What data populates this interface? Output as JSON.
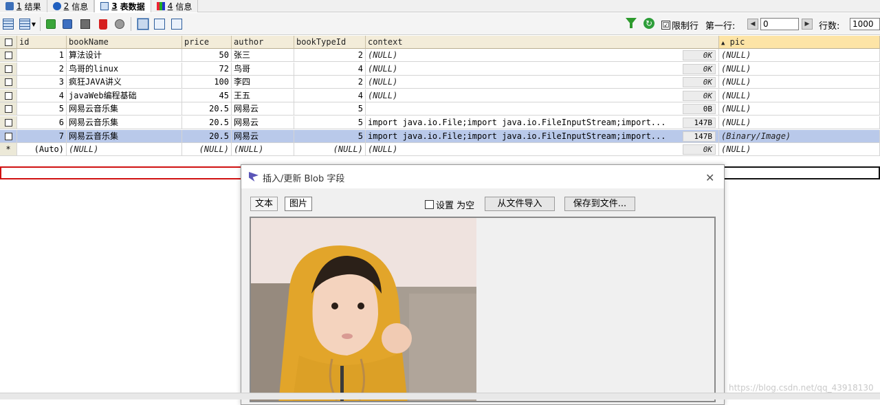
{
  "tabs": [
    {
      "num": "1",
      "label": "结果",
      "icon": "results-icon"
    },
    {
      "num": "2",
      "label": "信息",
      "icon": "info-icon"
    },
    {
      "num": "3",
      "label": "表数据",
      "icon": "table-data-icon"
    },
    {
      "num": "4",
      "label": "信息",
      "icon": "info-chart-icon"
    }
  ],
  "toolbar": {
    "limit_rows_label": "限制行",
    "limit_rows_checked": "☑",
    "first_row_label": "第一行:",
    "first_row_value": "0",
    "rows_label": "行数:",
    "rows_value": "1000"
  },
  "grid": {
    "columns": [
      "id",
      "bookName",
      "price",
      "author",
      "bookTypeId",
      "context",
      "pic"
    ],
    "sorted_marker": "▲",
    "rows": [
      {
        "id": "1",
        "bookName": "算法设计",
        "price": "50",
        "author": "张三",
        "bookTypeId": "2",
        "context": "(NULL)",
        "size": "0K",
        "pic": "(NULL)"
      },
      {
        "id": "2",
        "bookName": "鸟哥的linux",
        "price": "72",
        "author": "鸟哥",
        "bookTypeId": "4",
        "context": "(NULL)",
        "size": "0K",
        "pic": "(NULL)"
      },
      {
        "id": "3",
        "bookName": "疯狂JAVA讲义",
        "price": "100",
        "author": "李四",
        "bookTypeId": "2",
        "context": "(NULL)",
        "size": "0K",
        "pic": "(NULL)"
      },
      {
        "id": "4",
        "bookName": "javaWeb编程基础",
        "price": "45",
        "author": "王五",
        "bookTypeId": "4",
        "context": "(NULL)",
        "size": "0K",
        "pic": "(NULL)"
      },
      {
        "id": "5",
        "bookName": "网易云音乐集",
        "price": "20.5",
        "author": "网易云",
        "bookTypeId": "5",
        "context": "",
        "size": "0B",
        "pic": "(NULL)"
      },
      {
        "id": "6",
        "bookName": "网易云音乐集",
        "price": "20.5",
        "author": "网易云",
        "bookTypeId": "5",
        "context": "import java.io.File;import java.io.FileInputStream;import...",
        "size": "147B",
        "pic": "(NULL)"
      },
      {
        "id": "7",
        "bookName": "网易云音乐集",
        "price": "20.5",
        "author": "网易云",
        "bookTypeId": "5",
        "context": "import java.io.File;import java.io.FileInputStream;import...",
        "size": "147B",
        "pic": "(Binary/Image)"
      }
    ],
    "new_row": {
      "marker": "*",
      "id": "(Auto)",
      "bookName": "(NULL)",
      "price": "(NULL)",
      "author": "(NULL)",
      "bookTypeId": "(NULL)",
      "context": "(NULL)",
      "size": "0K",
      "pic": "(NULL)"
    }
  },
  "dialog": {
    "title": "插入/更新 Blob 字段",
    "close": "✕",
    "tab_text": "文本",
    "tab_image": "图片",
    "set_null_label": "设置 为空",
    "import_button": "从文件导入",
    "save_button": "保存到文件..."
  },
  "watermark": "https://blog.csdn.net/qq_43918130"
}
